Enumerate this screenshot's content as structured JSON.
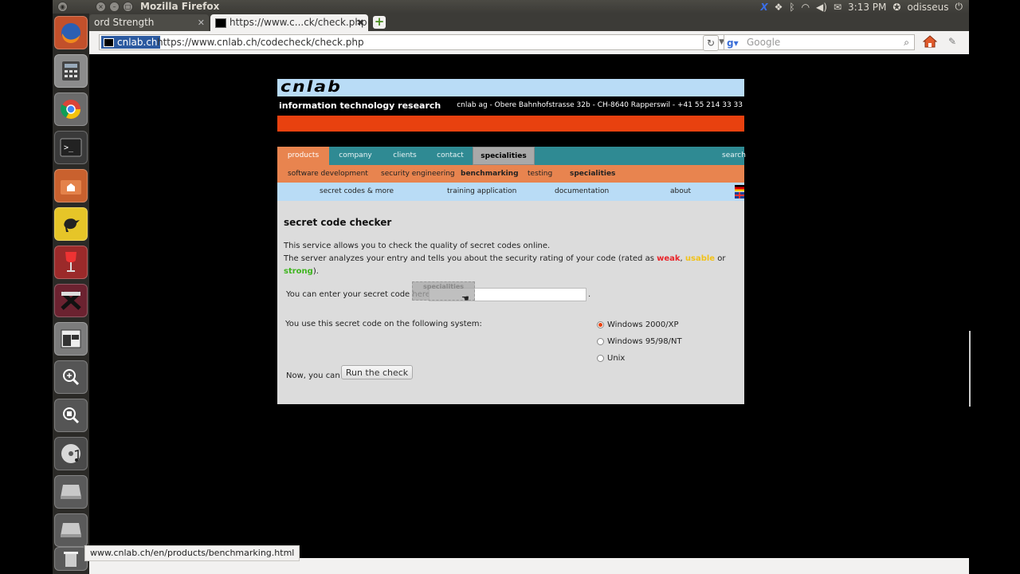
{
  "panel": {
    "app_title": "Mozilla Firefox",
    "time": "3:13 PM",
    "user": "odisseus"
  },
  "tabs": [
    {
      "label": "ord Strength"
    },
    {
      "label": "https://www.c...ck/check.php"
    }
  ],
  "navbar": {
    "identity": "cnlab.ch",
    "url": "https://www.cnlab.ch/codecheck/check.php",
    "search_placeholder": "Google"
  },
  "site": {
    "logo": "cnlab",
    "tagline": "information technology research",
    "address": "cnlab ag - Obere Bahnhofstrasse 32b - CH-8640 Rapperswil - +41 55 214 33 33",
    "main_nav": [
      "products",
      "company",
      "clients",
      "contact",
      "specialities",
      "search"
    ],
    "sub_nav": [
      "software development",
      "security engineering",
      "benchmarking",
      "testing",
      "specialities"
    ],
    "third_nav": [
      "secret codes & more",
      "training application",
      "documentation",
      "about"
    ]
  },
  "checker": {
    "title": "secret code checker",
    "desc_line1": "This service allows you to check the quality of secret codes online.",
    "desc_line2_pre": "The server analyzes your entry and tells you about the security rating of your code (rated as ",
    "weak": "weak",
    "sep1": ", ",
    "usable": "usable",
    "sep2": " or",
    "strong": "strong",
    "desc_end": ").",
    "enter_label": "You can enter your secret code here",
    "dot": ".",
    "drag_ghost": "specialities",
    "system_label": "You use this secret code on the following system:",
    "options": [
      "Windows 2000/XP",
      "Windows 95/98/NT",
      "Unix"
    ],
    "selected_option": "Windows 2000/XP",
    "now_label": "Now, you can",
    "run_button": "Run the check"
  },
  "status": {
    "link": "www.cnlab.ch/en/products/benchmarking.html"
  },
  "colors": {
    "red_bar": "#e8410f",
    "teal_nav": "#2f8a93",
    "orange_nav": "#e8844f",
    "light_blue": "#b9dcf6"
  }
}
